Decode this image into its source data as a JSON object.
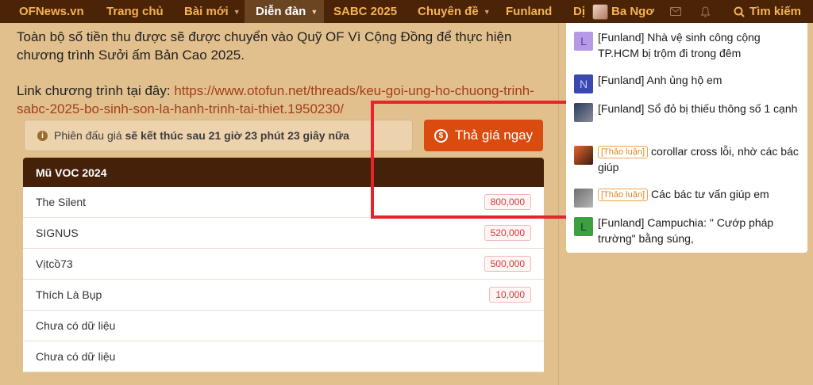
{
  "nav": {
    "logo": "OFNews.vn",
    "items": [
      {
        "label": "Trang chủ"
      },
      {
        "label": "Bài mới"
      },
      {
        "label": "Diễn đàn"
      },
      {
        "label": "SABC 2025"
      },
      {
        "label": "Chuyên đề"
      },
      {
        "label": "Funland"
      },
      {
        "label": "Dị"
      }
    ],
    "user_name": "Ba Ngơ",
    "search_label": "Tìm kiếm"
  },
  "content": {
    "paragraph1": "Toàn bộ số tiền thu được sẽ được chuyển vào Quỹ OF Vì Cộng Đồng để thực hiện chương trình Sưởi ấm Bản Cao 2025.",
    "link_prefix": "Link chương trình tại đây: ",
    "link_url": "https://www.otofun.net/threads/keu-goi-ung-ho-chuong-trinh-sabc-2025-bo-sinh-son-la-hanh-trinh-tai-thiet.1950230/"
  },
  "auction": {
    "notice_prefix": "Phiên đấu giá",
    "notice_bold": "sẽ kết thúc sau 21 giờ 23 phút 23 giây nữa",
    "bid_button": "Thả giá ngay",
    "table_title": "Mũ VOC 2024",
    "rows": [
      {
        "name": "The Silent",
        "amount": "800,000"
      },
      {
        "name": "SIGNUS",
        "amount": "520,000"
      },
      {
        "name": "Vịtcồ73",
        "amount": "500,000"
      },
      {
        "name": "Thích Là Bụp",
        "amount": "10,000"
      },
      {
        "name": "Chưa có dữ liệu",
        "amount": ""
      },
      {
        "name": "Chưa có dữ liệu",
        "amount": ""
      }
    ]
  },
  "sidebar": {
    "threads": [
      {
        "thumb": "L",
        "thumb_color": "#b69ae6",
        "tag": "",
        "title": "[Funland] Nhà vệ sinh công cộng TP.HCM bị trộm đi trong đêm"
      },
      {
        "thumb": "N",
        "thumb_color": "#3b48b0",
        "tag": "",
        "title": "[Funland] Anh ủng hộ em"
      },
      {
        "thumb": "",
        "thumb_color": "#5b5e6b",
        "tag": "",
        "title": "[Funland] Sổ đỏ bị thiếu thông số 1 cạnh"
      },
      {
        "thumb": "",
        "thumb_color": "#c4491f",
        "tag": "[Thảo luận]",
        "title": "corollar cross lỗi, nhờ các bác giúp"
      },
      {
        "thumb": "",
        "thumb_color": "#8d8d8d",
        "tag": "[Thảo luận]",
        "title": "Các bác tư vấn giúp em"
      },
      {
        "thumb": "L",
        "thumb_color": "#3aa041",
        "tag": "",
        "title": "[Funland] Campuchia: \" Cướp pháp trường\" bằng súng,"
      }
    ]
  },
  "colors": {
    "nav_bg": "#4b2307",
    "nav_text": "#f5b351",
    "bid_button": "#d94b0f",
    "highlight_box": "#e8232d"
  }
}
